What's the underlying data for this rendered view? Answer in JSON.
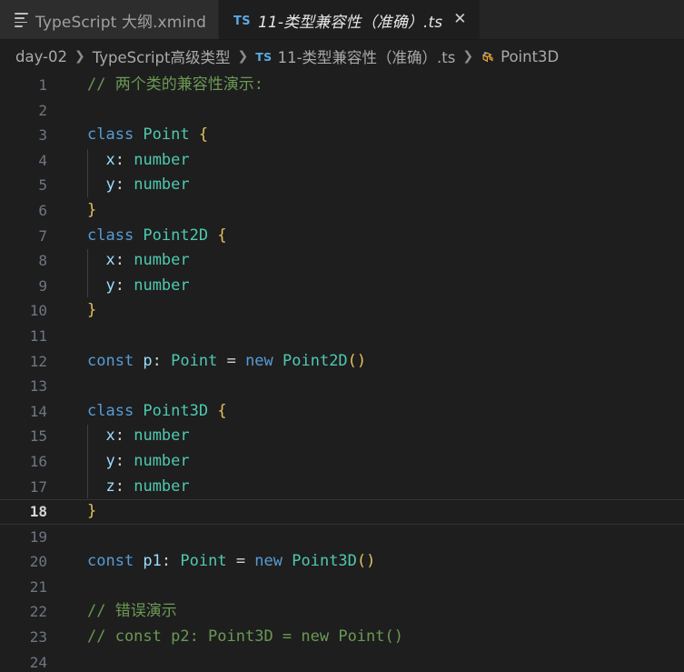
{
  "window": {
    "app": "Visual Studio Code",
    "theme_background": "#1e1e1e",
    "tabbar_background": "#252526"
  },
  "tabs": [
    {
      "label": "TypeScript 大纲.xmind",
      "icon": "outline-lines-icon",
      "active": false,
      "closable": false
    },
    {
      "label": "11-类型兼容性（准确）.ts",
      "badge": "TS",
      "icon": "typescript-file-icon",
      "active": true,
      "closable": true,
      "close_glyph": "✕"
    }
  ],
  "breadcrumb": {
    "separator": "❯",
    "items": [
      {
        "label": "day-02",
        "icon": "folder-crumb"
      },
      {
        "label": "TypeScript高级类型",
        "icon": "folder-crumb"
      },
      {
        "label": "11-类型兼容性（准确）.ts",
        "badge": "TS",
        "icon": "typescript-file-icon"
      },
      {
        "label": "Point3D",
        "icon": "class-symbol-icon"
      }
    ]
  },
  "editor": {
    "language": "typescript",
    "current_line": 18,
    "colors": {
      "comment": "#6A9955",
      "keyword": "#569CD6",
      "type": "#4EC9B0",
      "property": "#9CDCFE",
      "brace": "#E6C15C",
      "text": "#D4D4D4",
      "line_number": "#6E7681",
      "active_line_number": "#D6D6D6"
    },
    "lines": [
      {
        "n": "1",
        "tokens": [
          {
            "t": "// 两个类的兼容性演示:",
            "c": "comment"
          }
        ]
      },
      {
        "n": "2",
        "tokens": []
      },
      {
        "n": "3",
        "tokens": [
          {
            "t": "class ",
            "c": "keyword"
          },
          {
            "t": "Point ",
            "c": "type"
          },
          {
            "t": "{",
            "c": "brace"
          }
        ]
      },
      {
        "n": "4",
        "tokens": [
          {
            "t": "  ",
            "c": "punct"
          },
          {
            "t": "x",
            "c": "prop"
          },
          {
            "t": ": ",
            "c": "punct"
          },
          {
            "t": "number",
            "c": "type"
          }
        ],
        "guide": true
      },
      {
        "n": "5",
        "tokens": [
          {
            "t": "  ",
            "c": "punct"
          },
          {
            "t": "y",
            "c": "prop"
          },
          {
            "t": ": ",
            "c": "punct"
          },
          {
            "t": "number",
            "c": "type"
          }
        ],
        "guide": true
      },
      {
        "n": "6",
        "tokens": [
          {
            "t": "}",
            "c": "brace"
          }
        ]
      },
      {
        "n": "7",
        "tokens": [
          {
            "t": "class ",
            "c": "keyword"
          },
          {
            "t": "Point2D ",
            "c": "type"
          },
          {
            "t": "{",
            "c": "brace"
          }
        ]
      },
      {
        "n": "8",
        "tokens": [
          {
            "t": "  ",
            "c": "punct"
          },
          {
            "t": "x",
            "c": "prop"
          },
          {
            "t": ": ",
            "c": "punct"
          },
          {
            "t": "number",
            "c": "type"
          }
        ],
        "guide": true
      },
      {
        "n": "9",
        "tokens": [
          {
            "t": "  ",
            "c": "punct"
          },
          {
            "t": "y",
            "c": "prop"
          },
          {
            "t": ": ",
            "c": "punct"
          },
          {
            "t": "number",
            "c": "type"
          }
        ],
        "guide": true
      },
      {
        "n": "10",
        "tokens": [
          {
            "t": "}",
            "c": "brace"
          }
        ]
      },
      {
        "n": "11",
        "tokens": []
      },
      {
        "n": "12",
        "tokens": [
          {
            "t": "const ",
            "c": "keyword"
          },
          {
            "t": "p",
            "c": "var"
          },
          {
            "t": ": ",
            "c": "punct"
          },
          {
            "t": "Point ",
            "c": "type"
          },
          {
            "t": "= ",
            "c": "punct"
          },
          {
            "t": "new ",
            "c": "keyword"
          },
          {
            "t": "Point2D",
            "c": "type"
          },
          {
            "t": "()",
            "c": "paren"
          }
        ]
      },
      {
        "n": "13",
        "tokens": []
      },
      {
        "n": "14",
        "tokens": [
          {
            "t": "class ",
            "c": "keyword"
          },
          {
            "t": "Point3D ",
            "c": "type"
          },
          {
            "t": "{",
            "c": "brace"
          }
        ]
      },
      {
        "n": "15",
        "tokens": [
          {
            "t": "  ",
            "c": "punct"
          },
          {
            "t": "x",
            "c": "prop"
          },
          {
            "t": ": ",
            "c": "punct"
          },
          {
            "t": "number",
            "c": "type"
          }
        ],
        "guide": true
      },
      {
        "n": "16",
        "tokens": [
          {
            "t": "  ",
            "c": "punct"
          },
          {
            "t": "y",
            "c": "prop"
          },
          {
            "t": ": ",
            "c": "punct"
          },
          {
            "t": "number",
            "c": "type"
          }
        ],
        "guide": true
      },
      {
        "n": "17",
        "tokens": [
          {
            "t": "  ",
            "c": "punct"
          },
          {
            "t": "z",
            "c": "prop"
          },
          {
            "t": ": ",
            "c": "punct"
          },
          {
            "t": "number",
            "c": "type"
          }
        ],
        "guide": true
      },
      {
        "n": "18",
        "tokens": [
          {
            "t": "}",
            "c": "brace"
          }
        ],
        "current": true
      },
      {
        "n": "19",
        "tokens": []
      },
      {
        "n": "20",
        "tokens": [
          {
            "t": "const ",
            "c": "keyword"
          },
          {
            "t": "p1",
            "c": "var"
          },
          {
            "t": ": ",
            "c": "punct"
          },
          {
            "t": "Point ",
            "c": "type"
          },
          {
            "t": "= ",
            "c": "punct"
          },
          {
            "t": "new ",
            "c": "keyword"
          },
          {
            "t": "Point3D",
            "c": "type"
          },
          {
            "t": "()",
            "c": "paren"
          }
        ]
      },
      {
        "n": "21",
        "tokens": []
      },
      {
        "n": "22",
        "tokens": [
          {
            "t": "// 错误演示",
            "c": "comment"
          }
        ]
      },
      {
        "n": "23",
        "tokens": [
          {
            "t": "// const p2: Point3D = new Point()",
            "c": "comment"
          }
        ]
      },
      {
        "n": "24",
        "tokens": []
      }
    ]
  }
}
